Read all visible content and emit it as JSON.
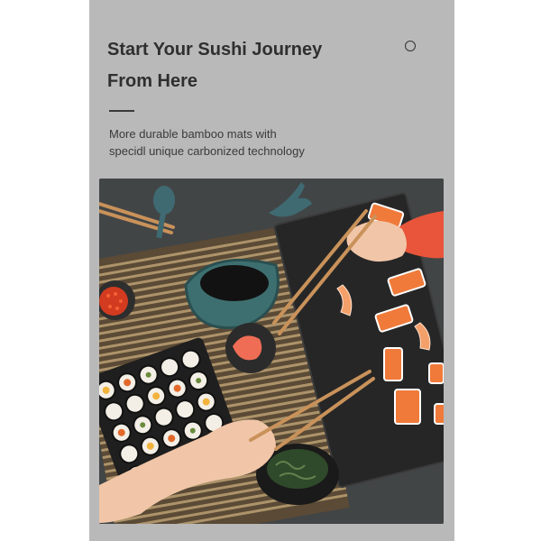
{
  "headline": {
    "line1": "Start Your Sushi Journey",
    "line2": "From Here"
  },
  "description": {
    "line1": "More durable bamboo mats with",
    "line2": "specidl unique carbonized technology"
  },
  "colors": {
    "panel_background": "#b9b9b9",
    "heading_text": "#2f2f2f",
    "body_text": "#3a3a3a",
    "table_surface": "#454849",
    "salmon": "#f07a3a",
    "sleeve": "#e8553a"
  },
  "icons": {
    "top_right": "ring-icon"
  }
}
